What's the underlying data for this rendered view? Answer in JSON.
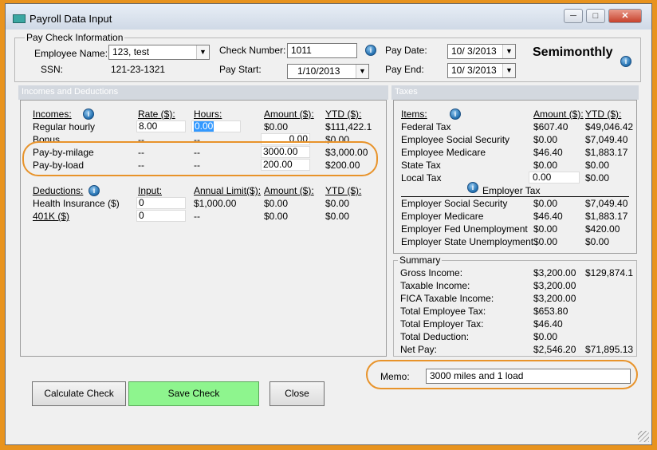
{
  "window": {
    "title": "Payroll Data Input",
    "buttons": {
      "minimize": "─",
      "maximize": "□",
      "close": "✕"
    }
  },
  "paycheck": {
    "group_label": "Pay Check Information",
    "employee_name_label": "Employee Name:",
    "employee_name_value": "123, test",
    "ssn_label": "SSN:",
    "ssn_value": "121-23-1321",
    "check_number_label": "Check Number:",
    "check_number_value": "1011",
    "pay_start_label": "Pay Start:",
    "pay_start_value": "1/10/2013",
    "pay_date_label": "Pay Date:",
    "pay_date_value": "10/  3/2013",
    "pay_end_label": "Pay End:",
    "pay_end_value": "10/  3/2013",
    "frequency": "Semimonthly"
  },
  "incomes_section": {
    "header": "Incomes and Deductions",
    "col_incomes": "Incomes:",
    "col_rate": "Rate ($):",
    "col_hours": "Hours:",
    "col_amount": "Amount ($):",
    "col_ytd": "YTD ($):",
    "rows": [
      {
        "name": "Regular hourly",
        "rate": "8.00",
        "hours": "0.00",
        "amount": "$0.00",
        "ytd": "$111,422.1"
      },
      {
        "name": "Bonus",
        "rate": "--",
        "hours": "--",
        "amount": "0.00",
        "ytd": "$0.00"
      },
      {
        "name": "Pay-by-milage",
        "rate": "--",
        "hours": "--",
        "amount": "3000.00",
        "ytd": "$3,000.00"
      },
      {
        "name": "Pay-by-load",
        "rate": "--",
        "hours": "--",
        "amount": "200.00",
        "ytd": "$200.00"
      }
    ],
    "col_deductions": "Deductions:",
    "col_input": "Input:",
    "col_annual_limit": "Annual Limit($):",
    "deductions": [
      {
        "name": "Health Insurance  ($)",
        "input": "0",
        "limit": "$1,000.00",
        "amount": "$0.00",
        "ytd": "$0.00"
      },
      {
        "name": "401K  ($)",
        "input": "0",
        "limit": "--",
        "amount": "$0.00",
        "ytd": "$0.00"
      }
    ]
  },
  "taxes_section": {
    "header": "Taxes",
    "col_items": "Items:",
    "col_amount": "Amount ($):",
    "col_ytd": "YTD ($):",
    "employee_rows": [
      {
        "name": "Federal Tax",
        "amount": "$607.40",
        "ytd": "$49,046.42"
      },
      {
        "name": "Employee Social Security",
        "amount": "$0.00",
        "ytd": "$7,049.40"
      },
      {
        "name": "Employee Medicare",
        "amount": "$46.40",
        "ytd": "$1,883.17"
      },
      {
        "name": "State Tax",
        "amount": "$0.00",
        "ytd": "$0.00"
      },
      {
        "name": "Local Tax",
        "amount": "0.00",
        "ytd": "$0.00"
      }
    ],
    "employer_label": "Employer Tax",
    "employer_rows": [
      {
        "name": "Employer Social Security",
        "amount": "$0.00",
        "ytd": "$7,049.40"
      },
      {
        "name": "Employer Medicare",
        "amount": "$46.40",
        "ytd": "$1,883.17"
      },
      {
        "name": "Employer Fed Unemployment",
        "amount": "$0.00",
        "ytd": "$420.00"
      },
      {
        "name": "Employer State Unemployment",
        "amount": "$0.00",
        "ytd": "$0.00"
      }
    ]
  },
  "summary": {
    "label": "Summary",
    "rows": [
      {
        "name": "Gross Income:",
        "amount": "$3,200.00",
        "ytd": "$129,874.1"
      },
      {
        "name": "Taxable Income:",
        "amount": "$3,200.00",
        "ytd": ""
      },
      {
        "name": "FICA Taxable Income:",
        "amount": "$3,200.00",
        "ytd": ""
      },
      {
        "name": "Total Employee Tax:",
        "amount": "$653.80",
        "ytd": ""
      },
      {
        "name": "Total Employer Tax:",
        "amount": "$46.40",
        "ytd": ""
      },
      {
        "name": "Total Deduction:",
        "amount": "$0.00",
        "ytd": ""
      },
      {
        "name": "Net Pay:",
        "amount": "$2,546.20",
        "ytd": "$71,895.13"
      }
    ]
  },
  "memo": {
    "label": "Memo:",
    "value": "3000 miles and 1 load"
  },
  "actions": {
    "calculate": "Calculate Check",
    "save": "Save Check",
    "close": "Close"
  },
  "colors": {
    "accent_orange": "#e8932a",
    "save_green": "#8ef58e",
    "section_header": "#d3d8df"
  }
}
